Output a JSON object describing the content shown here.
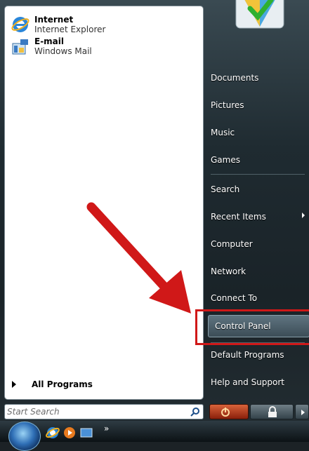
{
  "pinned": [
    {
      "title": "Internet",
      "sub": "Internet Explorer",
      "icon": "internet-explorer-icon"
    },
    {
      "title": "E-mail",
      "sub": "Windows Mail",
      "icon": "windows-mail-icon"
    }
  ],
  "left": {
    "all_programs": "All Programs"
  },
  "search": {
    "placeholder": "Start Search"
  },
  "right_items": {
    "documents": "Documents",
    "pictures": "Pictures",
    "music": "Music",
    "games": "Games",
    "search": "Search",
    "recent_items": "Recent Items",
    "computer": "Computer",
    "network": "Network",
    "connect_to": "Connect To",
    "control_panel": "Control Panel",
    "default_programs": "Default Programs",
    "help_support": "Help and Support"
  },
  "taskbar": {
    "overflow": "»"
  },
  "colors": {
    "annotation": "#d01818",
    "highlight": "#d01818"
  }
}
